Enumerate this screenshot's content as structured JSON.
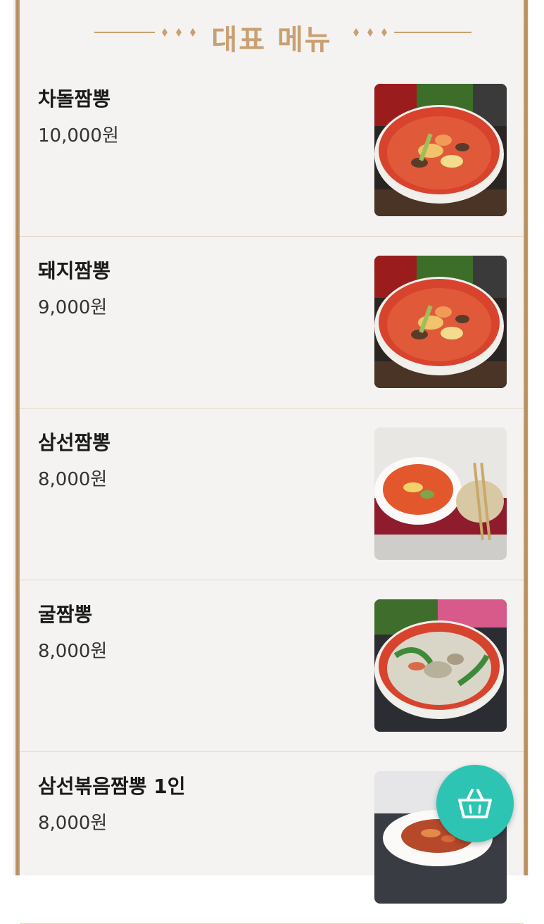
{
  "header": {
    "title": "대표 메뉴"
  },
  "menu": {
    "items": [
      {
        "name": "차돌짬뽕",
        "price": "10,000원",
        "photo": "red-jjamppong-photo"
      },
      {
        "name": "돼지짬뽕",
        "price": "9,000원",
        "photo": "red-jjamppong-photo"
      },
      {
        "name": "삼선짬뽕",
        "price": "8,000원",
        "photo": "samseon-jjamppong-photo"
      },
      {
        "name": "굴짬뽕",
        "price": "8,000원",
        "photo": "oyster-jjamppong-photo"
      },
      {
        "name": "삼선볶음짬뽕 1인",
        "price": "8,000원",
        "photo": "stirfried-jjamppong-photo"
      }
    ]
  },
  "colors": {
    "accent_gold": "#c9a073",
    "fab_teal": "#2ec4b4",
    "background": "#f4f3f1"
  },
  "cart_button": {
    "icon": "shopping-basket-icon"
  }
}
